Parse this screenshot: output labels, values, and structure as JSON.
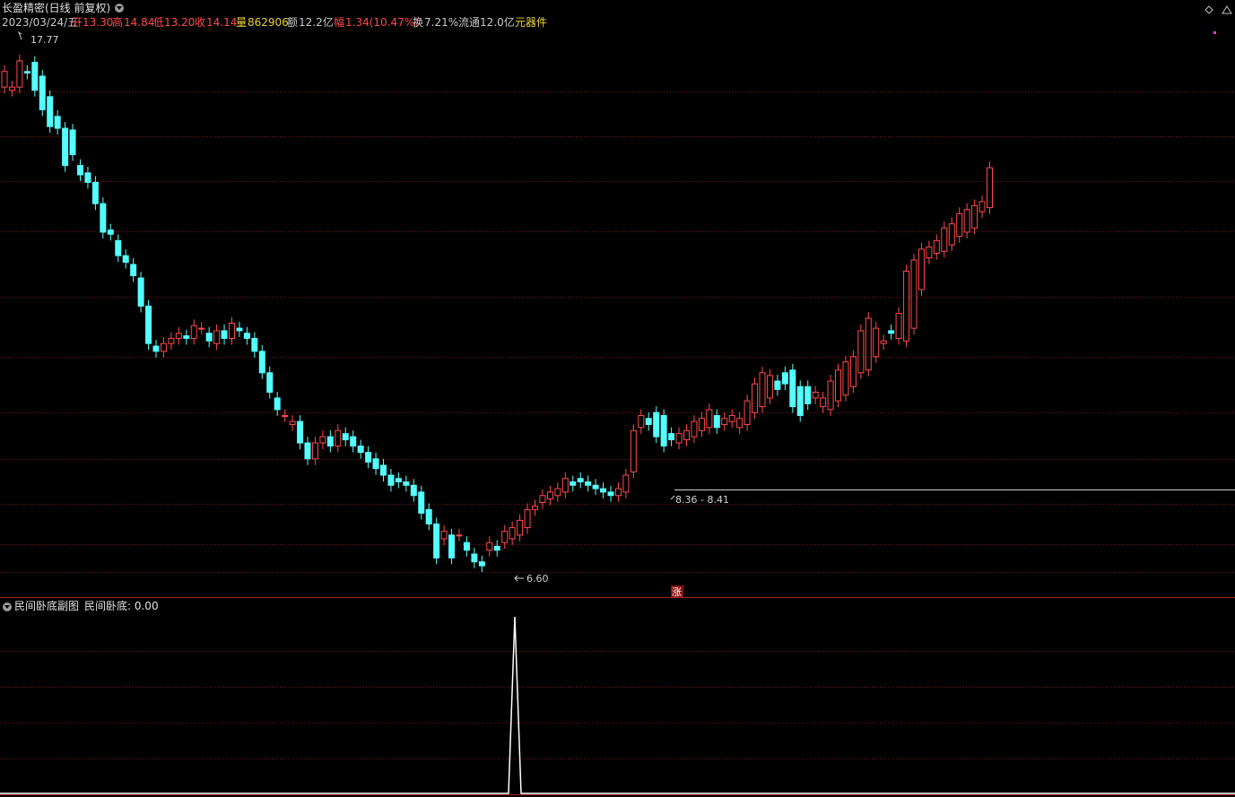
{
  "header": {
    "title": "长盈精密(日线 前复权)",
    "date": "2023/03/24/五",
    "open_label": "开",
    "open": "13.30",
    "high_label": "高",
    "high": "14.84",
    "low_label": "低",
    "low": "13.20",
    "close_label": "收",
    "close": "14.14",
    "volume_label": "量",
    "volume": "862906",
    "amount_label": "额",
    "amount": "12.2亿",
    "change_label": "幅",
    "change": "1.34(10.47%)",
    "turnover_label": "换",
    "turnover": "7.21%",
    "float_label": "流通",
    "float_value": "12.0亿",
    "concept": "元器件"
  },
  "indicator": {
    "title": "民间卧底副图",
    "line_label": "民间卧底",
    "value": ": 0.00"
  },
  "annotations": {
    "high_mark": "17.77",
    "low_mark": "6.60",
    "range_mark": "8.36 - 8.41",
    "limit_up_badge": "涨"
  },
  "colors": {
    "up": "#ff4a4a",
    "down": "#54ffff",
    "grid": "#7a1414",
    "separator": "#b02020",
    "background": "#000000",
    "concept": "#e8d230",
    "indicator_line": "#ffffff"
  },
  "chart_data": [
    {
      "type": "candlestick",
      "title": "长盈精密(日线 前复权)",
      "y_scale": "log",
      "ylim": [
        6.5,
        18.2
      ],
      "x": [
        1,
        2,
        3,
        4,
        5,
        6,
        7,
        8,
        9,
        10,
        11,
        12,
        13,
        14,
        15,
        16,
        17,
        18,
        19,
        20,
        21,
        22,
        23,
        24,
        25,
        26,
        27,
        28,
        29,
        30,
        31,
        32,
        33,
        34,
        35,
        36,
        37,
        38,
        39,
        40,
        41,
        42,
        43,
        44,
        45,
        46,
        47,
        48,
        49,
        50,
        51,
        52,
        53,
        54,
        55,
        56,
        57,
        58,
        59,
        60,
        61,
        62,
        63,
        64,
        65,
        66,
        67,
        68,
        69,
        70,
        71,
        72,
        73,
        74,
        75,
        76,
        77,
        78,
        79,
        80,
        81,
        82,
        83,
        84,
        85,
        86,
        87,
        88,
        89,
        90,
        91,
        92,
        93,
        94,
        95,
        96,
        97,
        98,
        99,
        100,
        101,
        102,
        103,
        104,
        105,
        106,
        107,
        108,
        109,
        110,
        111,
        112,
        113,
        114,
        115,
        116,
        117,
        118,
        119,
        120,
        121,
        122,
        123,
        124,
        125,
        126,
        127,
        128,
        129,
        130,
        131,
        132,
        133,
        134,
        135,
        136,
        137,
        138,
        139,
        140,
        141,
        142,
        143,
        144,
        145,
        146,
        147,
        148,
        149,
        150,
        151,
        152,
        153,
        154,
        155,
        156,
        157,
        158,
        159,
        160,
        161,
        162
      ],
      "open": [
        16.5,
        16.4,
        16.5,
        17.0,
        17.3,
        16.85,
        16.2,
        15.6,
        15.25,
        15.2,
        14.2,
        14.0,
        13.75,
        13.2,
        12.55,
        12.3,
        11.95,
        11.75,
        11.45,
        10.85,
        10.05,
        9.95,
        10.1,
        10.2,
        10.25,
        10.2,
        10.4,
        10.3,
        10.1,
        10.35,
        10.2,
        10.4,
        10.3,
        10.2,
        9.95,
        9.55,
        9.1,
        8.8,
        8.65,
        8.7,
        8.35,
        8.1,
        8.35,
        8.45,
        8.3,
        8.5,
        8.45,
        8.3,
        8.2,
        8.1,
        8.0,
        7.85,
        7.8,
        7.75,
        7.7,
        7.6,
        7.35,
        7.15,
        6.95,
        7.0,
        7.0,
        6.9,
        6.75,
        6.65,
        6.8,
        6.85,
        6.9,
        6.95,
        7.0,
        7.1,
        7.35,
        7.45,
        7.5,
        7.55,
        7.6,
        7.75,
        7.8,
        7.75,
        7.7,
        7.65,
        7.6,
        7.55,
        7.6,
        7.9,
        8.6,
        8.75,
        8.85,
        8.8,
        8.5,
        8.35,
        8.4,
        8.45,
        8.55,
        8.6,
        8.8,
        8.65,
        8.7,
        8.6,
        8.65,
        8.85,
        8.95,
        9.1,
        9.4,
        9.55,
        9.6,
        9.3,
        9.3,
        9.1,
        8.95,
        8.9,
        9.05,
        9.15,
        9.3,
        9.55,
        9.6,
        9.85,
        10.1,
        10.35,
        10.2,
        10.15,
        10.4,
        11.2,
        11.9,
        12.0,
        12.05,
        12.2,
        12.4,
        12.5,
        12.6,
        13.0,
        13.1,
        13.2,
        13.3
      ],
      "close": [
        17.0,
        16.5,
        17.35,
        16.95,
        16.4,
        15.8,
        15.3,
        15.25,
        14.2,
        14.5,
        13.95,
        13.75,
        13.2,
        12.5,
        12.45,
        11.95,
        11.8,
        11.5,
        10.85,
        10.1,
        9.95,
        10.1,
        10.2,
        10.3,
        10.2,
        10.45,
        10.4,
        10.15,
        10.35,
        10.2,
        10.5,
        10.35,
        10.2,
        9.95,
        9.55,
        9.2,
        8.9,
        8.8,
        8.7,
        8.35,
        8.1,
        8.35,
        8.45,
        8.3,
        8.55,
        8.4,
        8.3,
        8.2,
        8.05,
        7.95,
        7.85,
        7.7,
        7.75,
        7.7,
        7.55,
        7.3,
        7.15,
        6.7,
        7.05,
        6.7,
        7.0,
        6.8,
        6.65,
        6.6,
        6.9,
        6.8,
        7.05,
        7.1,
        7.2,
        7.35,
        7.4,
        7.55,
        7.6,
        7.65,
        7.8,
        7.7,
        7.75,
        7.7,
        7.65,
        7.6,
        7.55,
        7.65,
        7.85,
        8.55,
        8.8,
        8.65,
        8.45,
        8.3,
        8.4,
        8.5,
        8.55,
        8.7,
        8.75,
        8.9,
        8.6,
        8.75,
        8.8,
        8.75,
        9.05,
        9.35,
        9.55,
        9.5,
        9.25,
        9.35,
        8.95,
        8.8,
        9.0,
        9.2,
        9.1,
        9.4,
        9.6,
        9.75,
        9.85,
        10.35,
        10.6,
        10.4,
        10.15,
        10.3,
        10.7,
        11.6,
        11.85,
        12.1,
        12.15,
        12.3,
        12.6,
        12.7,
        12.95,
        13.05,
        13.15,
        13.25,
        14.14
      ]
    },
    {
      "type": "line",
      "title": "民间卧底副图",
      "series": [
        {
          "name": "民间卧底",
          "values": [
            0,
            0,
            0,
            1,
            0,
            0
          ],
          "x": [
            "",
            "",
            "",
            "",
            "",
            ""
          ]
        }
      ],
      "ylim": [
        0,
        1
      ]
    }
  ]
}
